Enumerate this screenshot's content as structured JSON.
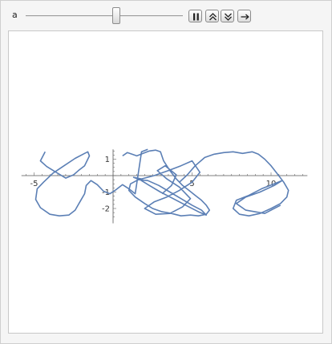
{
  "manipulate": {
    "parameter_label": "a",
    "slider_value_fraction": 0.58
  },
  "buttons": {
    "pause": "pause-icon",
    "faster": "double-chevron-up-icon",
    "slower": "double-chevron-down-icon",
    "direction": "right-arrow-icon"
  },
  "chart_data": {
    "type": "line",
    "title": "",
    "xlabel": "",
    "ylabel": "",
    "xlim": [
      -6.5,
      12.5
    ],
    "ylim": [
      -2.6,
      1.6
    ],
    "x_ticks": [
      -5,
      5,
      10
    ],
    "x_tick_labels": [
      "-5",
      "5",
      "10"
    ],
    "y_ticks": [
      1,
      -1,
      -2
    ],
    "y_tick_labels": [
      "1",
      "-1",
      "-2"
    ],
    "grid": false,
    "line_color": "#5b7fb5",
    "series": [
      {
        "x": [
          -4.3,
          -4.6,
          -4.2,
          -3.6,
          -3.0,
          -2.5,
          -2.2,
          -1.8,
          -1.5,
          -1.6,
          -1.8,
          -2.4,
          -3.1,
          -3.8,
          -4.4,
          -4.8,
          -4.9,
          -4.6,
          -4.0,
          -3.4,
          -2.8,
          -2.4,
          -2.1,
          -1.8,
          -1.7,
          -1.4,
          -1.0,
          -0.6,
          -0.2,
          0.2,
          0.6,
          1.0,
          1.4,
          1.8,
          2.2
        ],
        "y": [
          1.45,
          0.9,
          0.55,
          0.2,
          -0.15,
          0.05,
          0.3,
          0.6,
          1.2,
          1.45,
          1.35,
          1.05,
          0.6,
          0.15,
          -0.4,
          -0.8,
          -1.45,
          -1.95,
          -2.35,
          -2.45,
          -2.4,
          -2.1,
          -1.6,
          -1.1,
          -0.6,
          -0.3,
          -0.55,
          -0.95,
          -1.1,
          -0.85,
          -0.55,
          -0.8,
          -1.1,
          1.45,
          1.6
        ]
      },
      {
        "x": [
          0.6,
          0.9,
          1.2,
          1.5,
          1.9,
          2.3,
          2.7,
          3.0,
          3.2,
          3.6,
          4.0,
          4.4,
          4.8,
          5.2,
          5.6,
          5.9,
          6.1,
          5.9,
          5.4,
          4.9,
          4.3,
          3.7,
          3.1,
          2.5,
          2.0,
          1.4,
          1.0,
          1.1,
          1.6,
          2.2,
          2.9,
          3.6,
          4.3,
          5.0,
          5.6,
          5.9,
          5.4,
          4.6,
          3.8,
          3.0,
          2.3,
          1.7,
          1.3,
          1.8,
          2.6,
          3.5,
          4.3,
          5.0,
          5.5,
          5.0,
          4.2,
          3.4,
          2.6,
          2.0,
          2.7,
          3.6,
          4.4,
          4.9,
          4.2,
          3.4,
          2.8,
          3.3,
          4.0,
          3.7,
          3.1
        ],
        "y": [
          1.2,
          1.4,
          1.3,
          1.2,
          1.35,
          1.5,
          1.55,
          1.45,
          0.9,
          0.3,
          -0.2,
          -0.6,
          -0.9,
          -1.2,
          -1.5,
          -1.8,
          -2.1,
          -2.35,
          -2.45,
          -2.4,
          -2.45,
          -2.3,
          -2.2,
          -2.0,
          -1.7,
          -1.3,
          -0.9,
          -0.5,
          -0.25,
          -0.3,
          -0.6,
          -1.0,
          -1.4,
          -1.8,
          -2.1,
          -2.4,
          -2.2,
          -1.8,
          -1.4,
          -1.0,
          -0.6,
          -0.25,
          -0.1,
          -0.2,
          0.0,
          0.3,
          0.6,
          0.9,
          0.2,
          -0.4,
          -0.9,
          -1.3,
          -1.6,
          -2.0,
          -2.35,
          -2.3,
          -1.9,
          -1.4,
          -0.7,
          -0.2,
          0.3,
          0.6,
          0.05,
          -0.6,
          -1.1
        ]
      },
      {
        "x": [
          4.2,
          4.7,
          5.2,
          5.8,
          6.4,
          7.0,
          7.6,
          8.2,
          8.8,
          9.2,
          9.6,
          10.0,
          10.4,
          10.8,
          11.1,
          11.0,
          10.6,
          10.0,
          9.3,
          8.6,
          8.0,
          7.6,
          7.8,
          8.6,
          9.4,
          10.2,
          10.7,
          10.2,
          9.3,
          8.4,
          7.8,
          8.4,
          9.6,
          10.6
        ],
        "y": [
          -0.4,
          0.05,
          0.6,
          1.1,
          1.3,
          1.4,
          1.45,
          1.35,
          1.45,
          1.3,
          1.0,
          0.6,
          0.1,
          -0.4,
          -0.9,
          -1.3,
          -1.7,
          -2.0,
          -2.3,
          -2.45,
          -2.35,
          -2.0,
          -1.5,
          -1.2,
          -0.8,
          -0.5,
          -0.3,
          -0.6,
          -1.0,
          -1.3,
          -1.7,
          -2.1,
          -2.3,
          -1.8
        ]
      }
    ]
  }
}
